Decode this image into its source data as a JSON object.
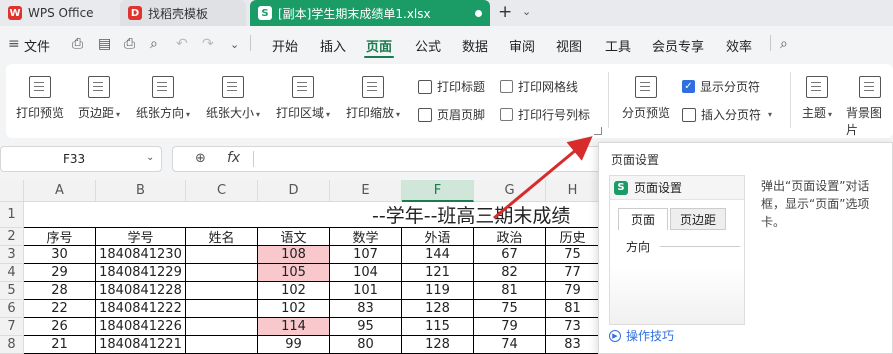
{
  "tabs": {
    "app": "WPS Office",
    "template": "找稻壳模板",
    "file": "[副本]学生期末成绩单1.xlsx"
  },
  "menubar": {
    "file": "文件",
    "items": [
      "开始",
      "插入",
      "页面",
      "公式",
      "数据",
      "审阅",
      "视图",
      "工具",
      "会员专享",
      "效率"
    ]
  },
  "ribbon": {
    "print_preview": "打印预览",
    "margins": "页边距",
    "orientation": "纸张方向",
    "paper_size": "纸张大小",
    "print_area": "打印区域",
    "print_scale": "打印缩放",
    "print_titles": "打印标题",
    "header_footer": "页眉页脚",
    "print_gridlines": "打印网格线",
    "print_row_col_headers": "打印行号列标",
    "page_break_preview": "分页预览",
    "show_page_breaks": "显示分页符",
    "insert_page_break": "插入分页符",
    "theme": "主题",
    "background": "背景图片"
  },
  "formula_bar": {
    "cell_ref": "F33",
    "fx": "fx"
  },
  "sheet": {
    "columns": [
      "A",
      "B",
      "C",
      "D",
      "E",
      "F",
      "G",
      "H"
    ],
    "rows": [
      "1",
      "2",
      "3",
      "4",
      "5",
      "6",
      "7",
      "8"
    ],
    "title": "--学年--班高三期末成绩",
    "headers": [
      "序号",
      "学号",
      "姓名",
      "语文",
      "数学",
      "外语",
      "政治",
      "历史"
    ],
    "data": [
      [
        "30",
        "1840841230",
        "",
        "108",
        "107",
        "144",
        "67",
        "75"
      ],
      [
        "29",
        "1840841229",
        "",
        "105",
        "104",
        "121",
        "82",
        "77"
      ],
      [
        "28",
        "1840841228",
        "",
        "102",
        "101",
        "119",
        "81",
        "79"
      ],
      [
        "22",
        "1840841222",
        "",
        "102",
        "83",
        "128",
        "75",
        "81"
      ],
      [
        "26",
        "1840841226",
        "",
        "114",
        "95",
        "115",
        "79",
        "73"
      ],
      [
        "21",
        "1840841221",
        "",
        "99",
        "80",
        "128",
        "74",
        "83"
      ]
    ],
    "highlighted_cells": [
      "3-3",
      "4-3",
      "7-3"
    ],
    "highlight_color": "#f8c8cc"
  },
  "tooltip": {
    "title": "页面设置",
    "preview_header": "页面设置",
    "preview_tab1": "页面",
    "preview_tab2": "页边距",
    "preview_label": "方向",
    "description": "弹出“页面设置”对话框，显示“页面”选项卡。",
    "help": "操作技巧"
  },
  "colors": {
    "accent": "#1b7a4f",
    "file_tab": "#1b9c66",
    "arrow": "#d62c2c"
  }
}
